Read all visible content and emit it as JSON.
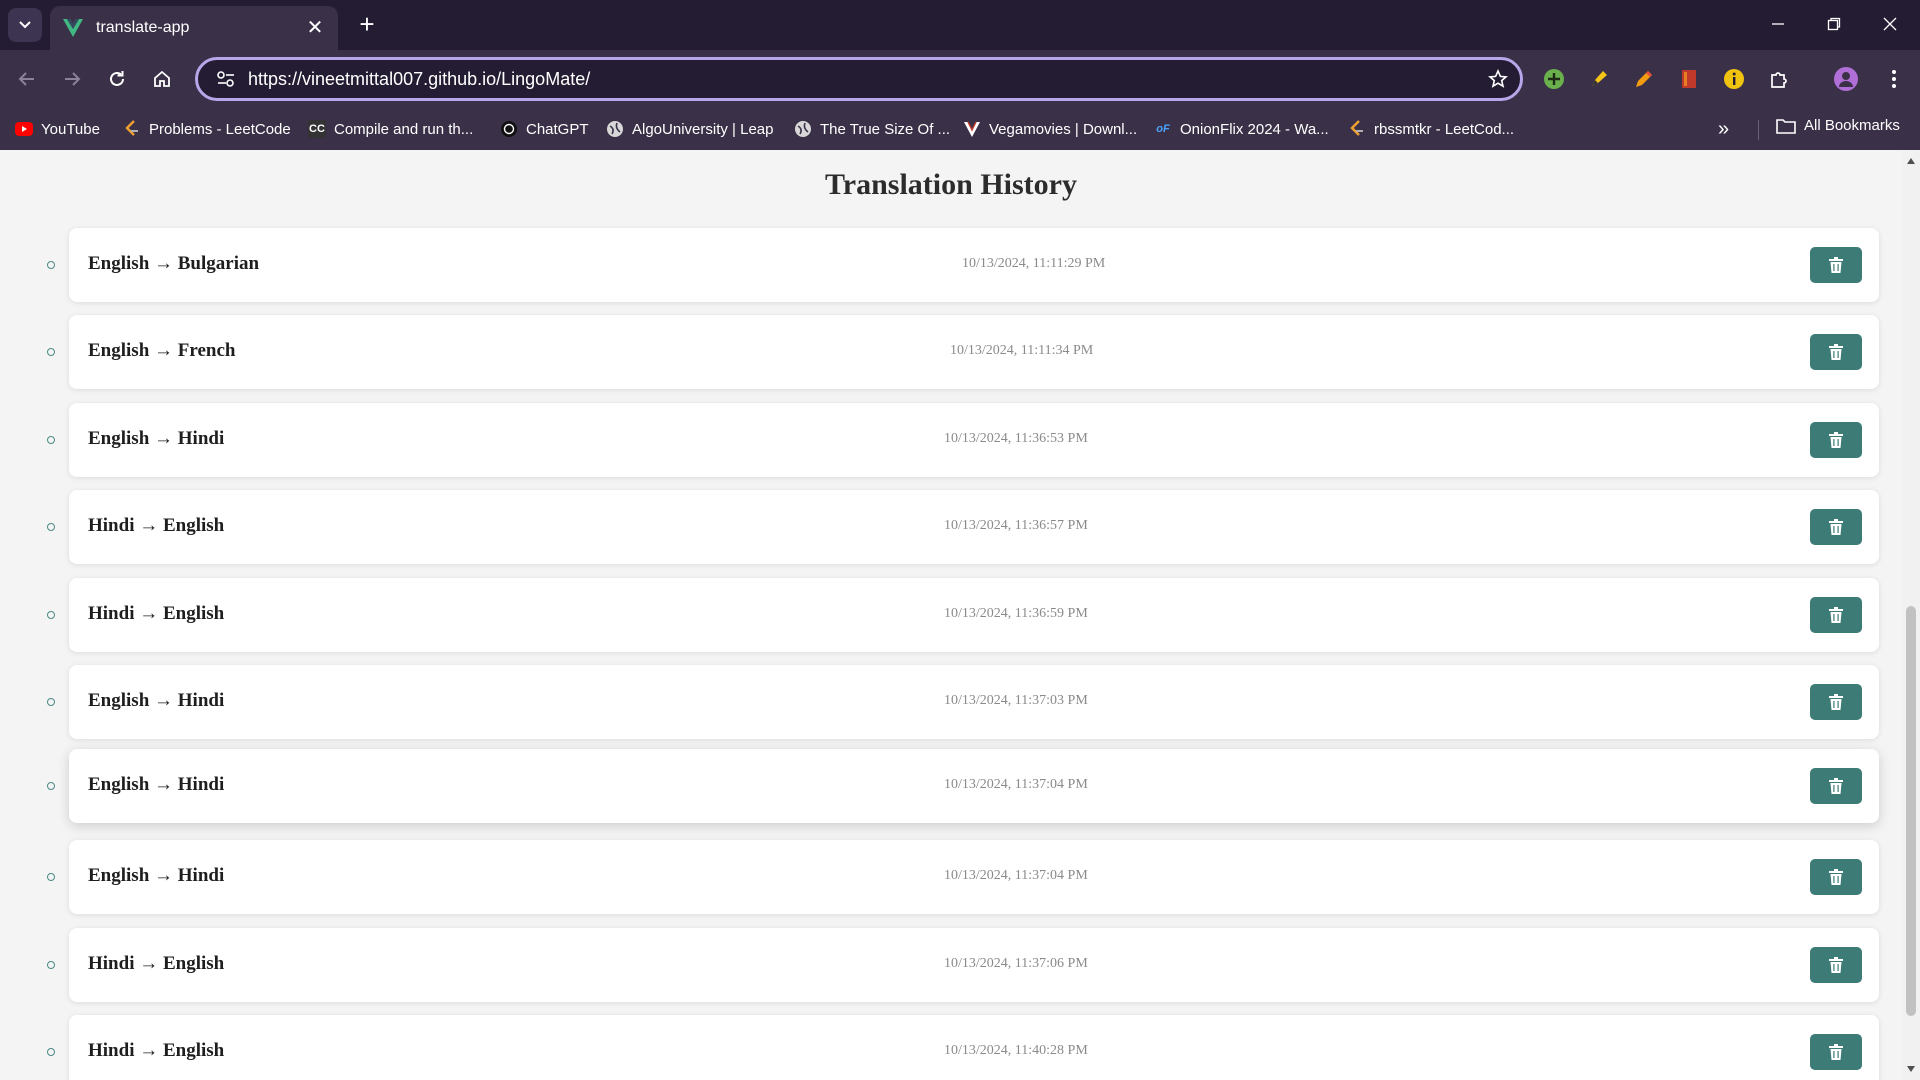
{
  "browser": {
    "tab_title": "translate-app",
    "url": "https://vineetmittal007.github.io/LingoMate/",
    "accent_color": "#b7a6e8",
    "bookmarks": [
      {
        "label": "YouTube",
        "icon": "youtube-icon"
      },
      {
        "label": "Problems - LeetCode",
        "icon": "leetcode-icon"
      },
      {
        "label": "Compile and run th...",
        "icon": "cc-icon"
      },
      {
        "label": "ChatGPT",
        "icon": "chatgpt-icon"
      },
      {
        "label": "AlgoUniversity | Leap",
        "icon": "globe-icon"
      },
      {
        "label": "The True Size Of ...",
        "icon": "globe-icon"
      },
      {
        "label": "Vegamovies | Downl...",
        "icon": "v-logo-icon"
      },
      {
        "label": "OnionFlix 2024 - Wa...",
        "icon": "of-icon"
      },
      {
        "label": "rbssmtkr - LeetCod...",
        "icon": "leetcode-icon"
      }
    ],
    "all_bookmarks_label": "All Bookmarks"
  },
  "page": {
    "title": "Translation History",
    "button_color": "#3d7b77",
    "history": [
      {
        "pair": "English → Bulgarian",
        "time": "10/13/2024, 11:11:29 PM"
      },
      {
        "pair": "English → French",
        "time": "10/13/2024, 11:11:34 PM"
      },
      {
        "pair": "English → Hindi",
        "time": "10/13/2024, 11:36:53 PM"
      },
      {
        "pair": "Hindi → English",
        "time": "10/13/2024, 11:36:57 PM"
      },
      {
        "pair": "Hindi → English",
        "time": "10/13/2024, 11:36:59 PM"
      },
      {
        "pair": "English → Hindi",
        "time": "10/13/2024, 11:37:03 PM"
      },
      {
        "pair": "English → Hindi",
        "time": "10/13/2024, 11:37:04 PM"
      },
      {
        "pair": "English → Hindi",
        "time": "10/13/2024, 11:37:04 PM"
      },
      {
        "pair": "Hindi → English",
        "time": "10/13/2024, 11:37:06 PM"
      },
      {
        "pair": "Hindi → English",
        "time": "10/13/2024, 11:40:28 PM"
      }
    ]
  }
}
